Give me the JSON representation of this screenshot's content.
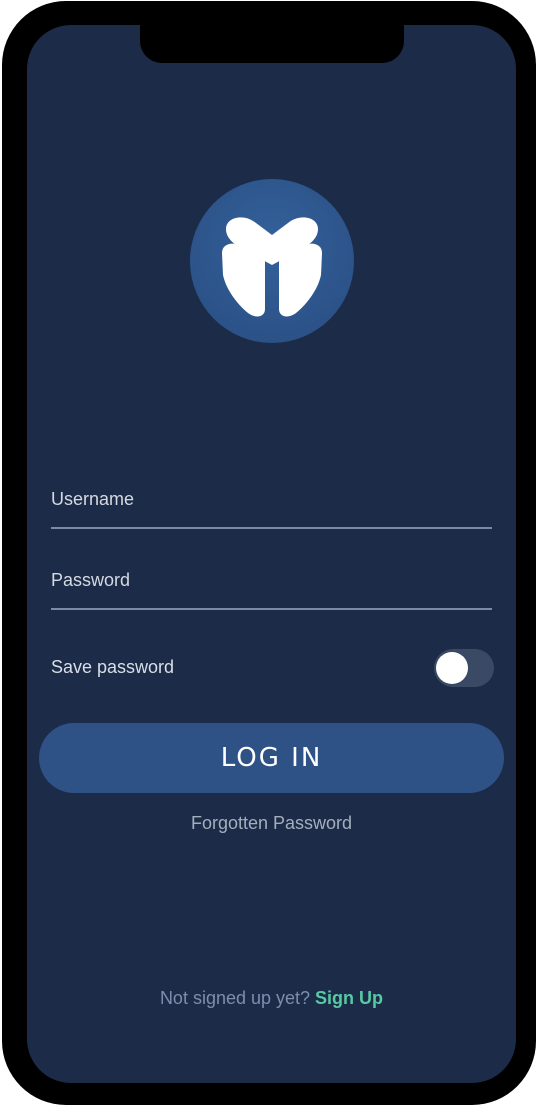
{
  "login": {
    "username_placeholder": "Username",
    "password_placeholder": "Password",
    "save_password_label": "Save password",
    "save_password_enabled": false,
    "login_button_label": "LOG IN",
    "forgot_password_label": "Forgotten Password",
    "signup_prompt": "Not signed up yet?",
    "signup_link_label": "Sign Up"
  },
  "icons": {
    "logo": "app-logo-icon"
  },
  "colors": {
    "background": "#1b2b48",
    "frame": "#000000",
    "primary": "#2e5286",
    "logo_circle": "#2c5389",
    "accent_green": "#57c9a3",
    "text_light": "#d9dee7",
    "text_muted": "#a5aebc",
    "underline": "#7d8aa3"
  }
}
